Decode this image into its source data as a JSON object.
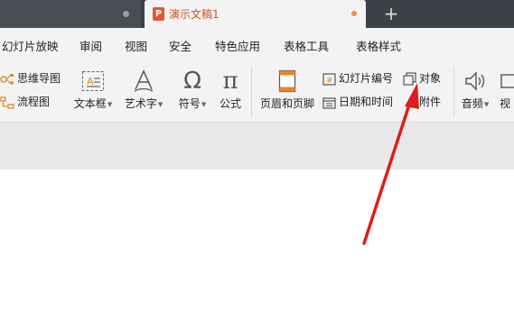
{
  "tabs": {
    "active_title": "演示文稿1",
    "new_tab_label": "+"
  },
  "menu": {
    "items": [
      "幻灯片放映",
      "审阅",
      "视图",
      "安全",
      "特色应用",
      "表格工具",
      "表格样式"
    ]
  },
  "ribbon": {
    "mindmap": "思维导图",
    "flowchart": "流程图",
    "textbox": "文本框",
    "wordart": "艺术字",
    "symbol": "符号",
    "formula": "公式",
    "header_footer": "页眉和页脚",
    "slide_number": "幻灯片编号",
    "datetime": "日期和时间",
    "object": "对象",
    "attachment": "附件",
    "audio": "音频",
    "video_partial": "视"
  },
  "colors": {
    "accent": "#d0501f",
    "annotation_arrow": "#e01b1b"
  }
}
